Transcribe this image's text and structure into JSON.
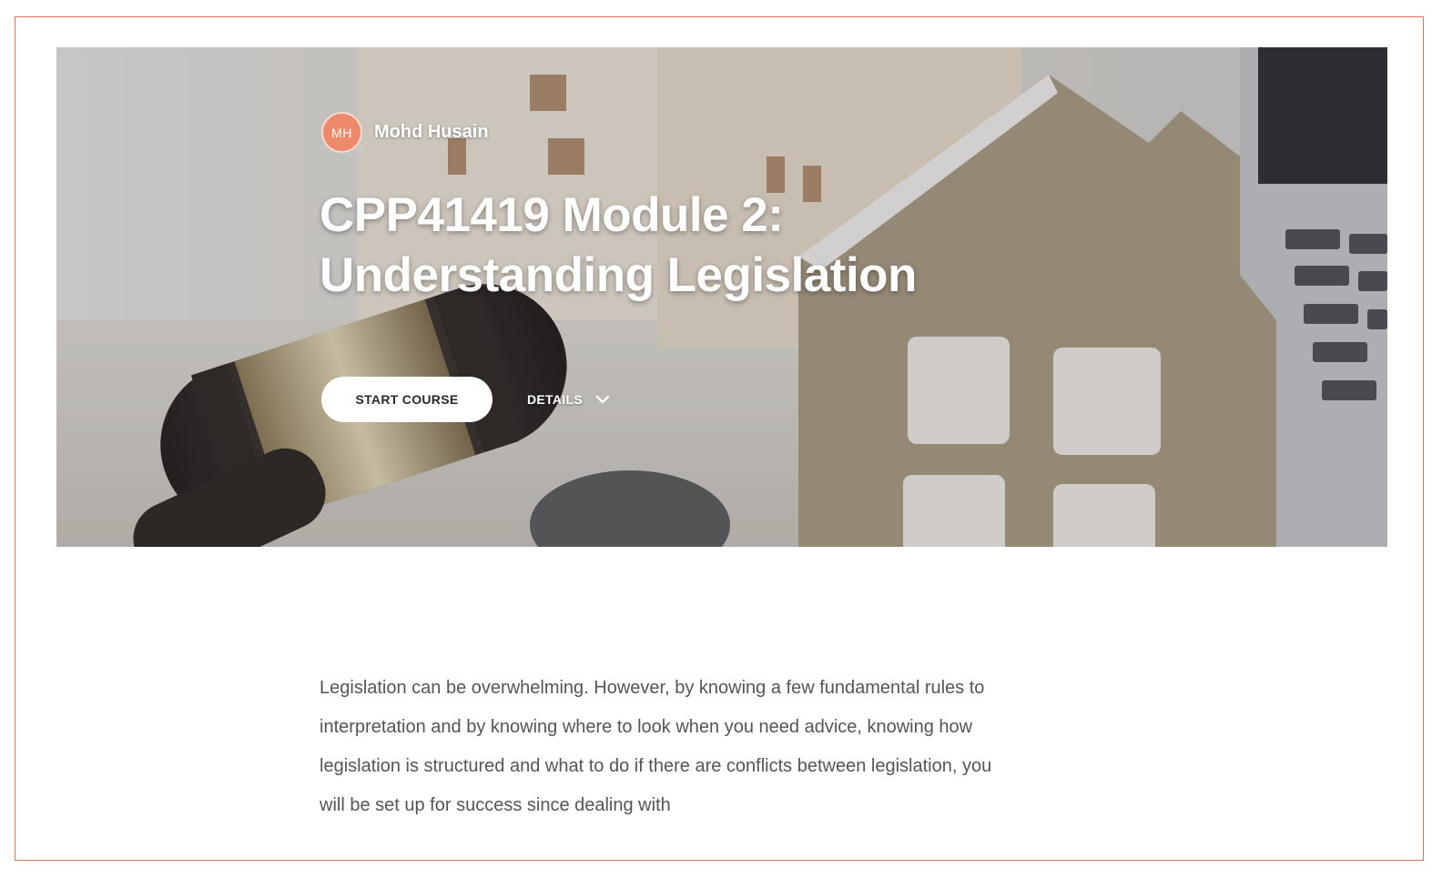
{
  "course": {
    "author": {
      "initials": "MH",
      "name": "Mohd Husain"
    },
    "title_line1": "CPP41419 Module 2:",
    "title_line2": "Understanding Legislation",
    "start_button": "START COURSE",
    "details_button": "DETAILS",
    "description": "Legislation can be overwhelming. However, by knowing a few fundamental rules to interpretation and by knowing where to look when you need advice, knowing how legislation is structured and what to do if there are conflicts between legislation, you will be set up for success since dealing with"
  },
  "icons": {
    "details_toggle": "chevron-down-icon"
  },
  "colors": {
    "frame_border": "#d9715f",
    "avatar_bg": "#ee8a6c",
    "body_text": "#555555"
  }
}
